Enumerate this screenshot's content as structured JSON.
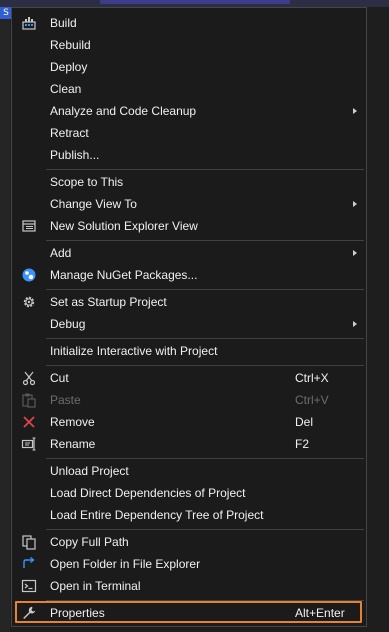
{
  "window": {
    "corner_tag": "S"
  },
  "menu": {
    "items": [
      {
        "label": "Build",
        "icon": "build-icon"
      },
      {
        "label": "Rebuild"
      },
      {
        "label": "Deploy"
      },
      {
        "label": "Clean"
      },
      {
        "label": "Analyze and Code Cleanup",
        "submenu": true
      },
      {
        "label": "Retract"
      },
      {
        "label": "Publish..."
      },
      {
        "label": "Scope to This"
      },
      {
        "label": "Change View To",
        "submenu": true
      },
      {
        "label": "New Solution Explorer View",
        "icon": "solution-explorer-icon"
      },
      {
        "label": "Add",
        "submenu": true
      },
      {
        "label": "Manage NuGet Packages...",
        "icon": "nuget-icon"
      },
      {
        "label": "Set as Startup Project",
        "icon": "gear-icon"
      },
      {
        "label": "Debug",
        "submenu": true
      },
      {
        "label": "Initialize Interactive with Project"
      },
      {
        "label": "Cut",
        "shortcut": "Ctrl+X",
        "icon": "scissors-icon"
      },
      {
        "label": "Paste",
        "shortcut": "Ctrl+V",
        "icon": "paste-icon",
        "disabled": true
      },
      {
        "label": "Remove",
        "shortcut": "Del",
        "icon": "remove-icon"
      },
      {
        "label": "Rename",
        "shortcut": "F2",
        "icon": "rename-icon"
      },
      {
        "label": "Unload Project"
      },
      {
        "label": "Load Direct Dependencies of Project"
      },
      {
        "label": "Load Entire Dependency Tree of Project"
      },
      {
        "label": "Copy Full Path",
        "icon": "copy-icon"
      },
      {
        "label": "Open Folder in File Explorer",
        "icon": "open-folder-icon"
      },
      {
        "label": "Open in Terminal",
        "icon": "terminal-icon"
      },
      {
        "label": "Properties",
        "shortcut": "Alt+Enter",
        "icon": "wrench-icon",
        "highlighted": true
      }
    ]
  },
  "colors": {
    "menu_bg": "#1b1b1c",
    "text": "#f1f1f1",
    "disabled_text": "#6d6d6d",
    "separator": "#3f3f46",
    "highlight_border": "#e8822d",
    "remove_red": "#e04545",
    "accent_blue": "#3794ff"
  }
}
